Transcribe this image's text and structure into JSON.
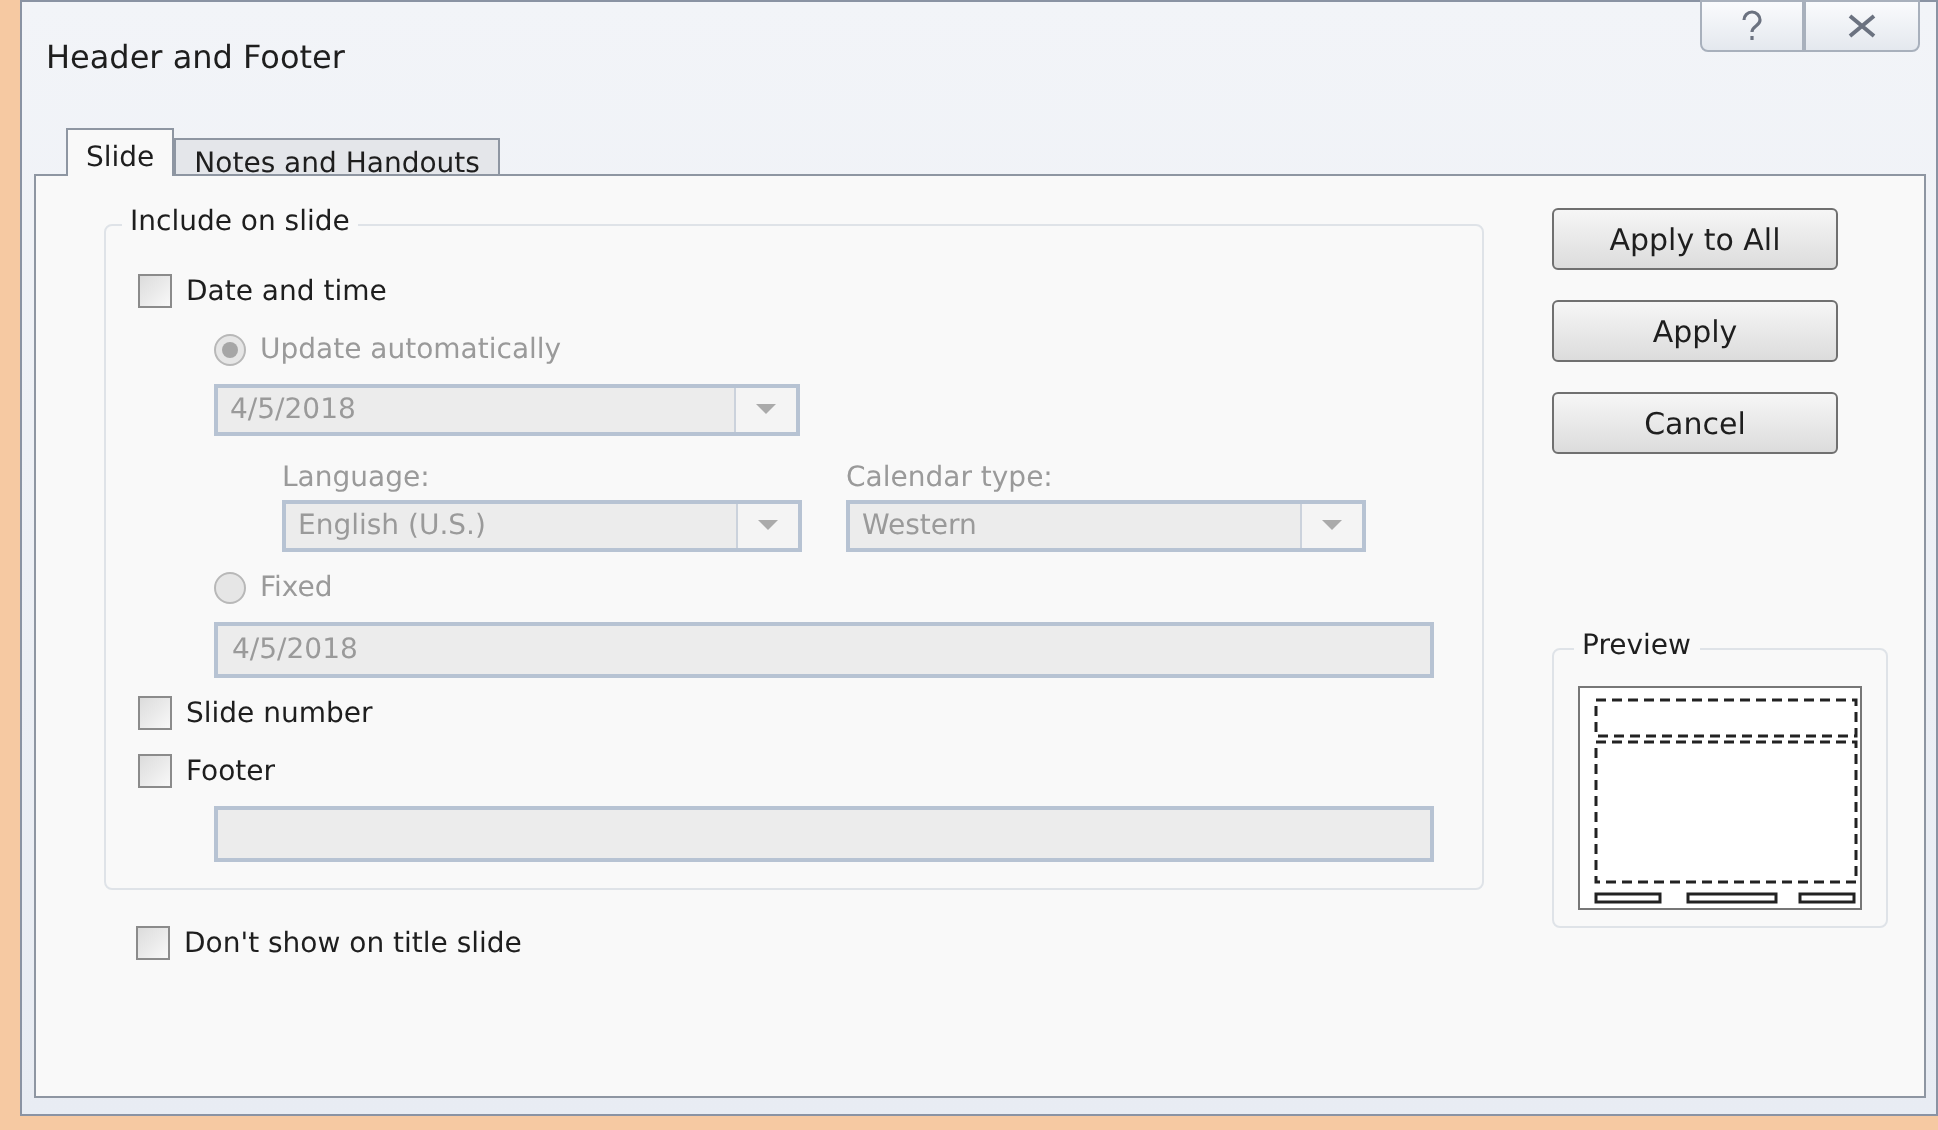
{
  "window": {
    "title": "Header and Footer"
  },
  "tabs": [
    {
      "label": "Slide",
      "selected": true
    },
    {
      "label": "Notes and Handouts",
      "selected": false
    }
  ],
  "include_group": {
    "title": "Include on slide",
    "date_and_time": {
      "label": "Date and time",
      "checked": false
    },
    "update_automatically": {
      "label": "Update automatically",
      "selected": true,
      "disabled": true
    },
    "date_format": {
      "value": "4/5/2018",
      "disabled": true
    },
    "language": {
      "label": "Language:",
      "value": "English (U.S.)",
      "disabled": true
    },
    "calendar_type": {
      "label": "Calendar type:",
      "value": "Western",
      "disabled": true
    },
    "fixed": {
      "label": "Fixed",
      "selected": false,
      "disabled": true
    },
    "fixed_date": {
      "value": "4/5/2018",
      "disabled": true
    },
    "slide_number": {
      "label": "Slide number",
      "checked": false
    },
    "footer": {
      "label": "Footer",
      "checked": false
    },
    "footer_text": {
      "disabled": true
    }
  },
  "dont_show_on_title_slide": {
    "label": "Don't show on title slide",
    "checked": false
  },
  "buttons": [
    "Apply to All",
    "Apply",
    "Cancel"
  ],
  "preview": {
    "title": "Preview"
  }
}
